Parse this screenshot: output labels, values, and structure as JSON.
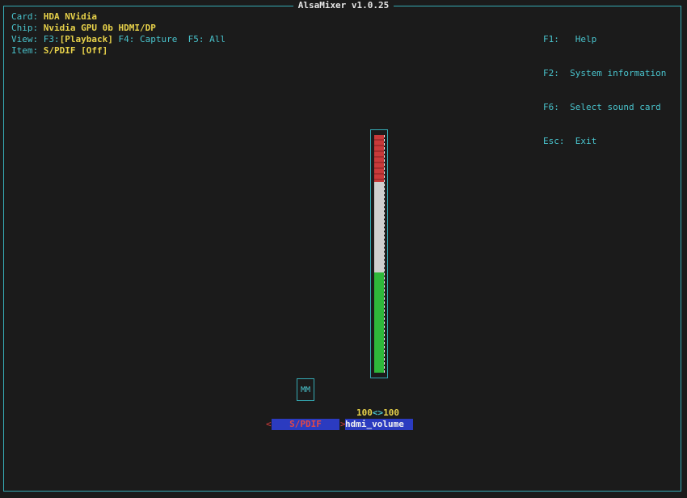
{
  "window": {
    "title": "AlsaMixer v1.0.25"
  },
  "info": {
    "card_label": "Card:",
    "card_value": "HDA NVidia",
    "chip_label": "Chip:",
    "chip_value": "Nvidia GPU 0b HDMI/DP",
    "view_label": "View:",
    "view_f3_key": "F3:",
    "view_f3_value": "[Playback]",
    "view_f4": "F4: Capture",
    "view_f5": "F5: All",
    "item_label": "Item:",
    "item_value": "S/PDIF [Off]"
  },
  "keys": [
    {
      "key": "F1:",
      "action": "Help"
    },
    {
      "key": "F2:",
      "action": "System information"
    },
    {
      "key": "F6:",
      "action": "Select sound card"
    },
    {
      "key": "Esc:",
      "action": "Exit"
    }
  ],
  "controls": {
    "mm_label": "MM",
    "volume_left": "100",
    "volume_arrows": "<>",
    "volume_right": "100",
    "volume_level": 1.0,
    "left_marker": "<",
    "spdif_label": "S/PDIF",
    "right_marker": ">",
    "hdmi_label": "hdmi_volume"
  },
  "colors": {
    "border": "#35aab4",
    "label": "#49c3cc",
    "value": "#e8d24a",
    "selected_bg": "#2b3bc0",
    "meter_red": "#c83a3a",
    "meter_white": "#cfcfcf",
    "meter_green": "#2eb83a"
  }
}
